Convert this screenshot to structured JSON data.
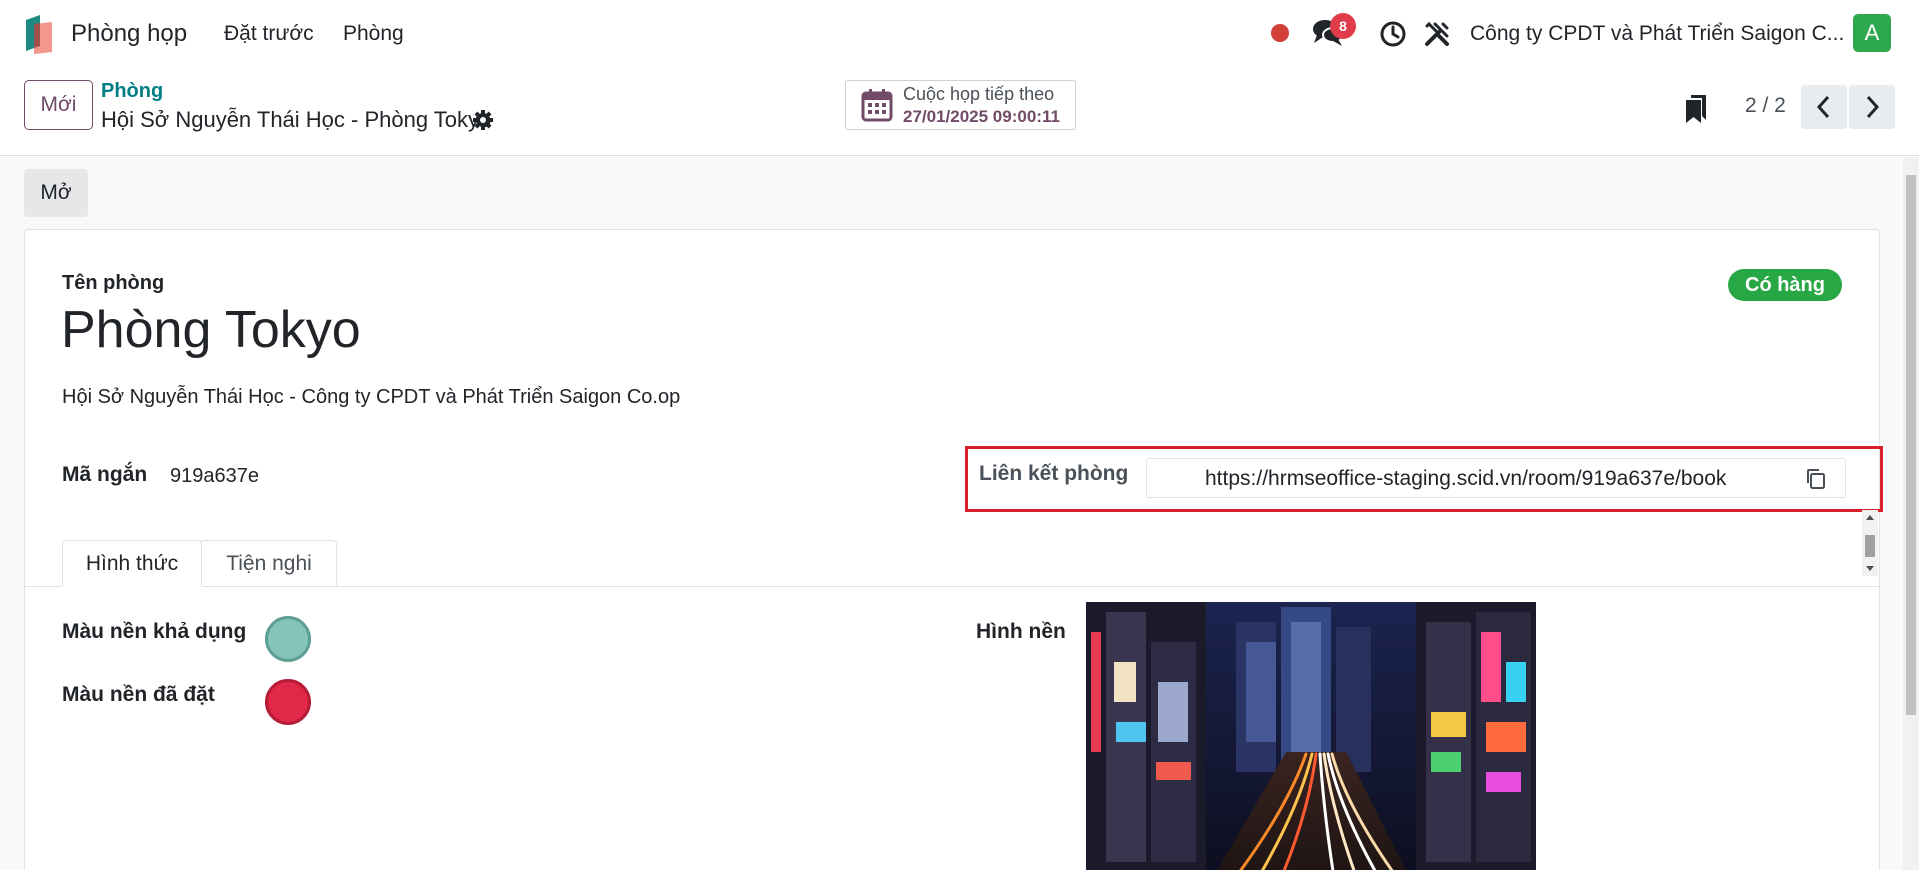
{
  "navbar": {
    "app_name": "Phòng họp",
    "menu": [
      "Đặt trước",
      "Phòng"
    ],
    "message_count": "8",
    "company": "Công ty CPDT và Phát Triển Saigon C...",
    "avatar_initial": "A",
    "colors": {
      "status_dot": "#d23f3a",
      "badge": "#e03c49",
      "avatar": "#2ea84f"
    },
    "icons": [
      "app-logo-icon",
      "chat-icon",
      "clock-icon",
      "tools-icon"
    ]
  },
  "control_panel": {
    "new_button": "Mới",
    "breadcrumb_parent": "Phòng",
    "breadcrumb_current": "Hội Sở Nguyễn Thái Học - Phòng Tokyo",
    "next_meeting_label": "Cuộc họp tiếp theo",
    "next_meeting_value": "27/01/2025 09:00:11",
    "pager": "2 / 2",
    "icons": [
      "gear-icon",
      "calendar-icon",
      "bookmark-icon",
      "chevron-left-icon",
      "chevron-right-icon"
    ]
  },
  "form": {
    "open_button": "Mở",
    "status": "Có hàng",
    "name_label": "Tên phòng",
    "room_name": "Phòng Tokyo",
    "location": "Hội Sở Nguyễn Thái Học - Công ty CPDT và Phát Triển Saigon Co.op",
    "code_label": "Mã ngắn",
    "code_value": "919a637e",
    "link_label": "Liên kết phòng",
    "link_value": "https://hrmseoffice-staging.scid.vn/room/919a637e/book",
    "tabs": [
      {
        "label": "Hình thức",
        "active": true
      },
      {
        "label": "Tiện nghi",
        "active": false
      }
    ],
    "available_color_label": "Màu nền khả dụng",
    "available_color": "#84c4b9",
    "booked_color_label": "Màu nền đã đặt",
    "booked_color": "#e02949",
    "background_label": "Hình nền",
    "colors": {
      "status": "#28a745",
      "highlight_box": "#d6202e",
      "brand": "#714b67",
      "link": "#017e84"
    }
  }
}
